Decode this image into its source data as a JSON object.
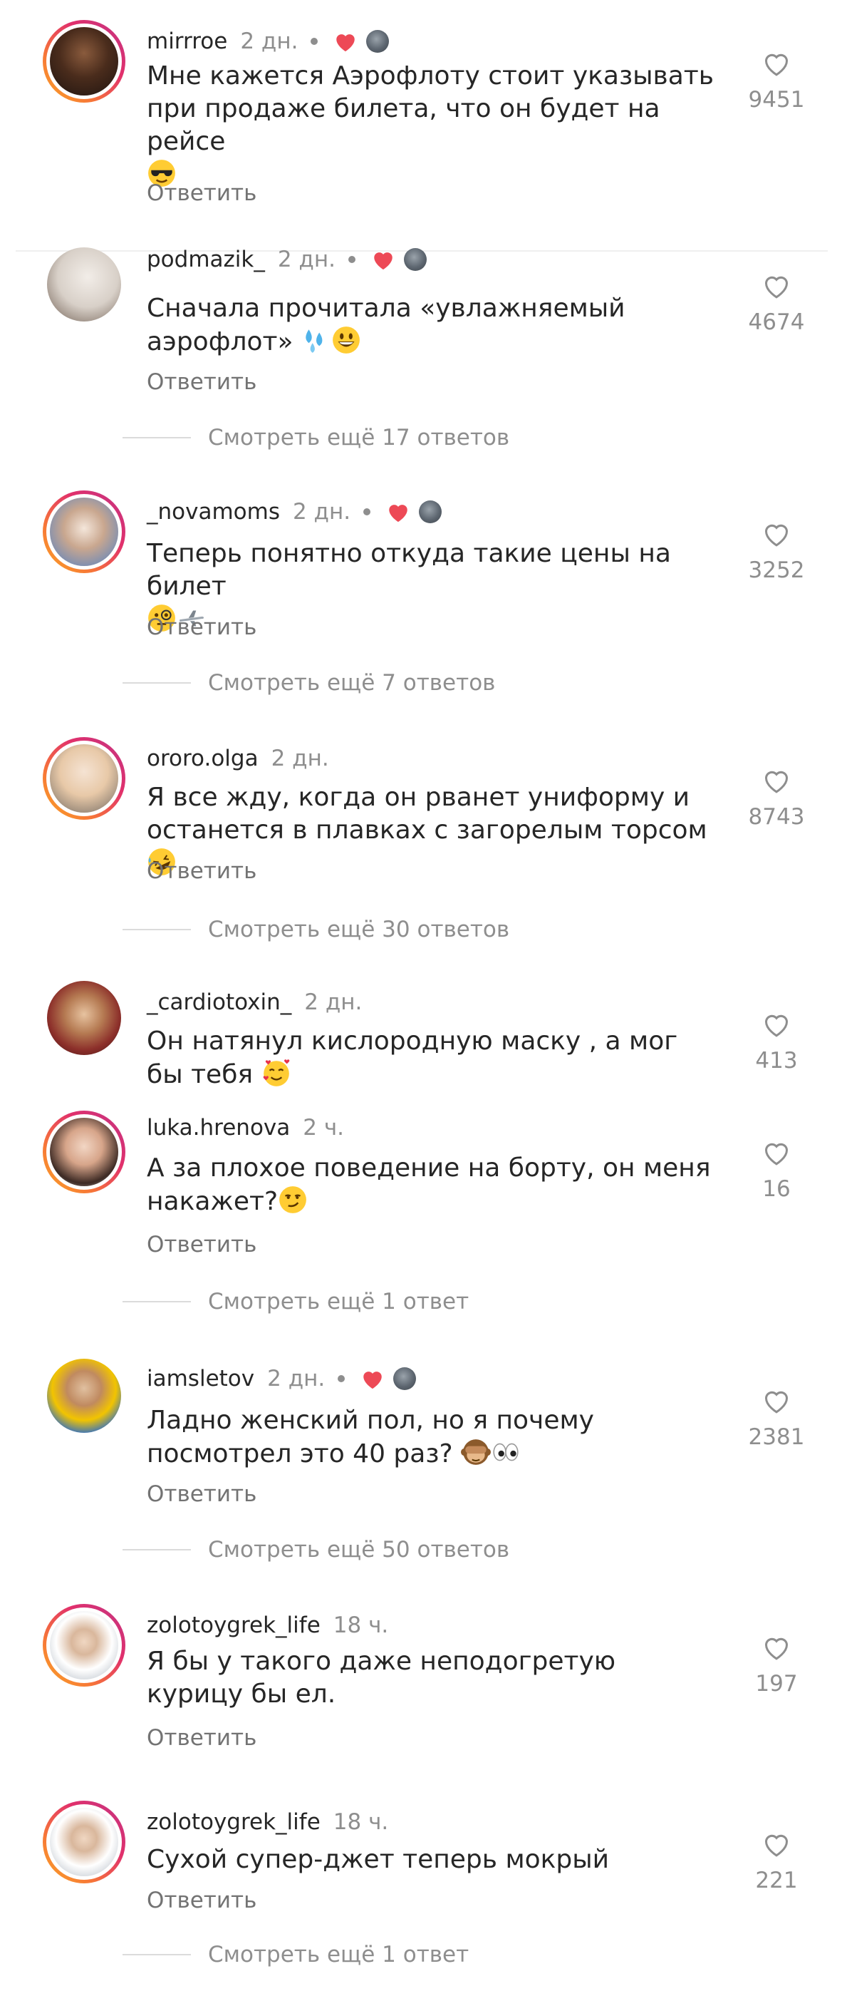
{
  "reply_label": "Ответить",
  "comments": [
    {
      "username": "mirrroe",
      "time": "2 дн.",
      "author_liked": true,
      "text": "Мне кажется Аэрофлоту стоит указывать при продаже билета, что он будет  на рейсе",
      "likes": "9451",
      "emoji": [
        "sunglasses-face"
      ],
      "view_more": ""
    },
    {
      "username": "podmazik_",
      "time": "2 дн.",
      "author_liked": true,
      "text": "Сначала прочитала «увлажняемый аэрофлот»",
      "likes": "4674",
      "emoji": [
        "sweat-droplets",
        "grinning-face"
      ],
      "view_more": "Смотреть ещё 17 ответов"
    },
    {
      "username": "_novamoms",
      "time": "2 дн.",
      "author_liked": true,
      "text": "Теперь понятно откуда такие цены на билет",
      "likes": "3252",
      "emoji": [
        "face-with-monocle",
        "airplane"
      ],
      "view_more": "Смотреть ещё 7 ответов"
    },
    {
      "username": "ororo.olga",
      "time": "2 дн.",
      "author_liked": false,
      "text": "Я все жду, когда он рванет униформу и останется в плавках с загорелым торсом",
      "likes": "8743",
      "emoji": [
        "rofl-face"
      ],
      "view_more": "Смотреть ещё 30 ответов"
    },
    {
      "username": "_cardiotoxin_",
      "time": "2 дн.",
      "author_liked": false,
      "text": "Он натянул кислородную маску , а мог бы тебя",
      "likes": "413",
      "emoji": [
        "smiling-face-with-hearts"
      ],
      "view_more": ""
    },
    {
      "username": "luka.hrenova",
      "time": "2 ч.",
      "author_liked": false,
      "text": "А за плохое поведение на борту, он меня накажет?",
      "likes": "16",
      "emoji": [
        "smirking-face"
      ],
      "view_more": "Смотреть ещё 1 ответ"
    },
    {
      "username": "iamsletov",
      "time": "2 дн.",
      "author_liked": true,
      "text": "Ладно женский пол, но я почему посмотрел это 40 раз?",
      "likes": "2381",
      "emoji": [
        "see-no-evil-monkey",
        "eyes"
      ],
      "view_more": "Смотреть ещё 50 ответов"
    },
    {
      "username": "zolotoygrek_life",
      "time": "18 ч.",
      "author_liked": false,
      "text": "Я бы у такого даже неподогретую курицу бы ел.",
      "likes": "197",
      "emoji": [],
      "view_more": ""
    },
    {
      "username": "zolotoygrek_life",
      "time": "18 ч.",
      "author_liked": false,
      "text": "Сухой супер-джет теперь мокрый",
      "likes": "221",
      "emoji": [],
      "view_more": "Смотреть ещё 1 ответ"
    }
  ],
  "colors": {
    "liked_heart": "#ed4956",
    "story_ring": "#e1306c",
    "text": "#262626",
    "muted": "#8e8e8e"
  }
}
